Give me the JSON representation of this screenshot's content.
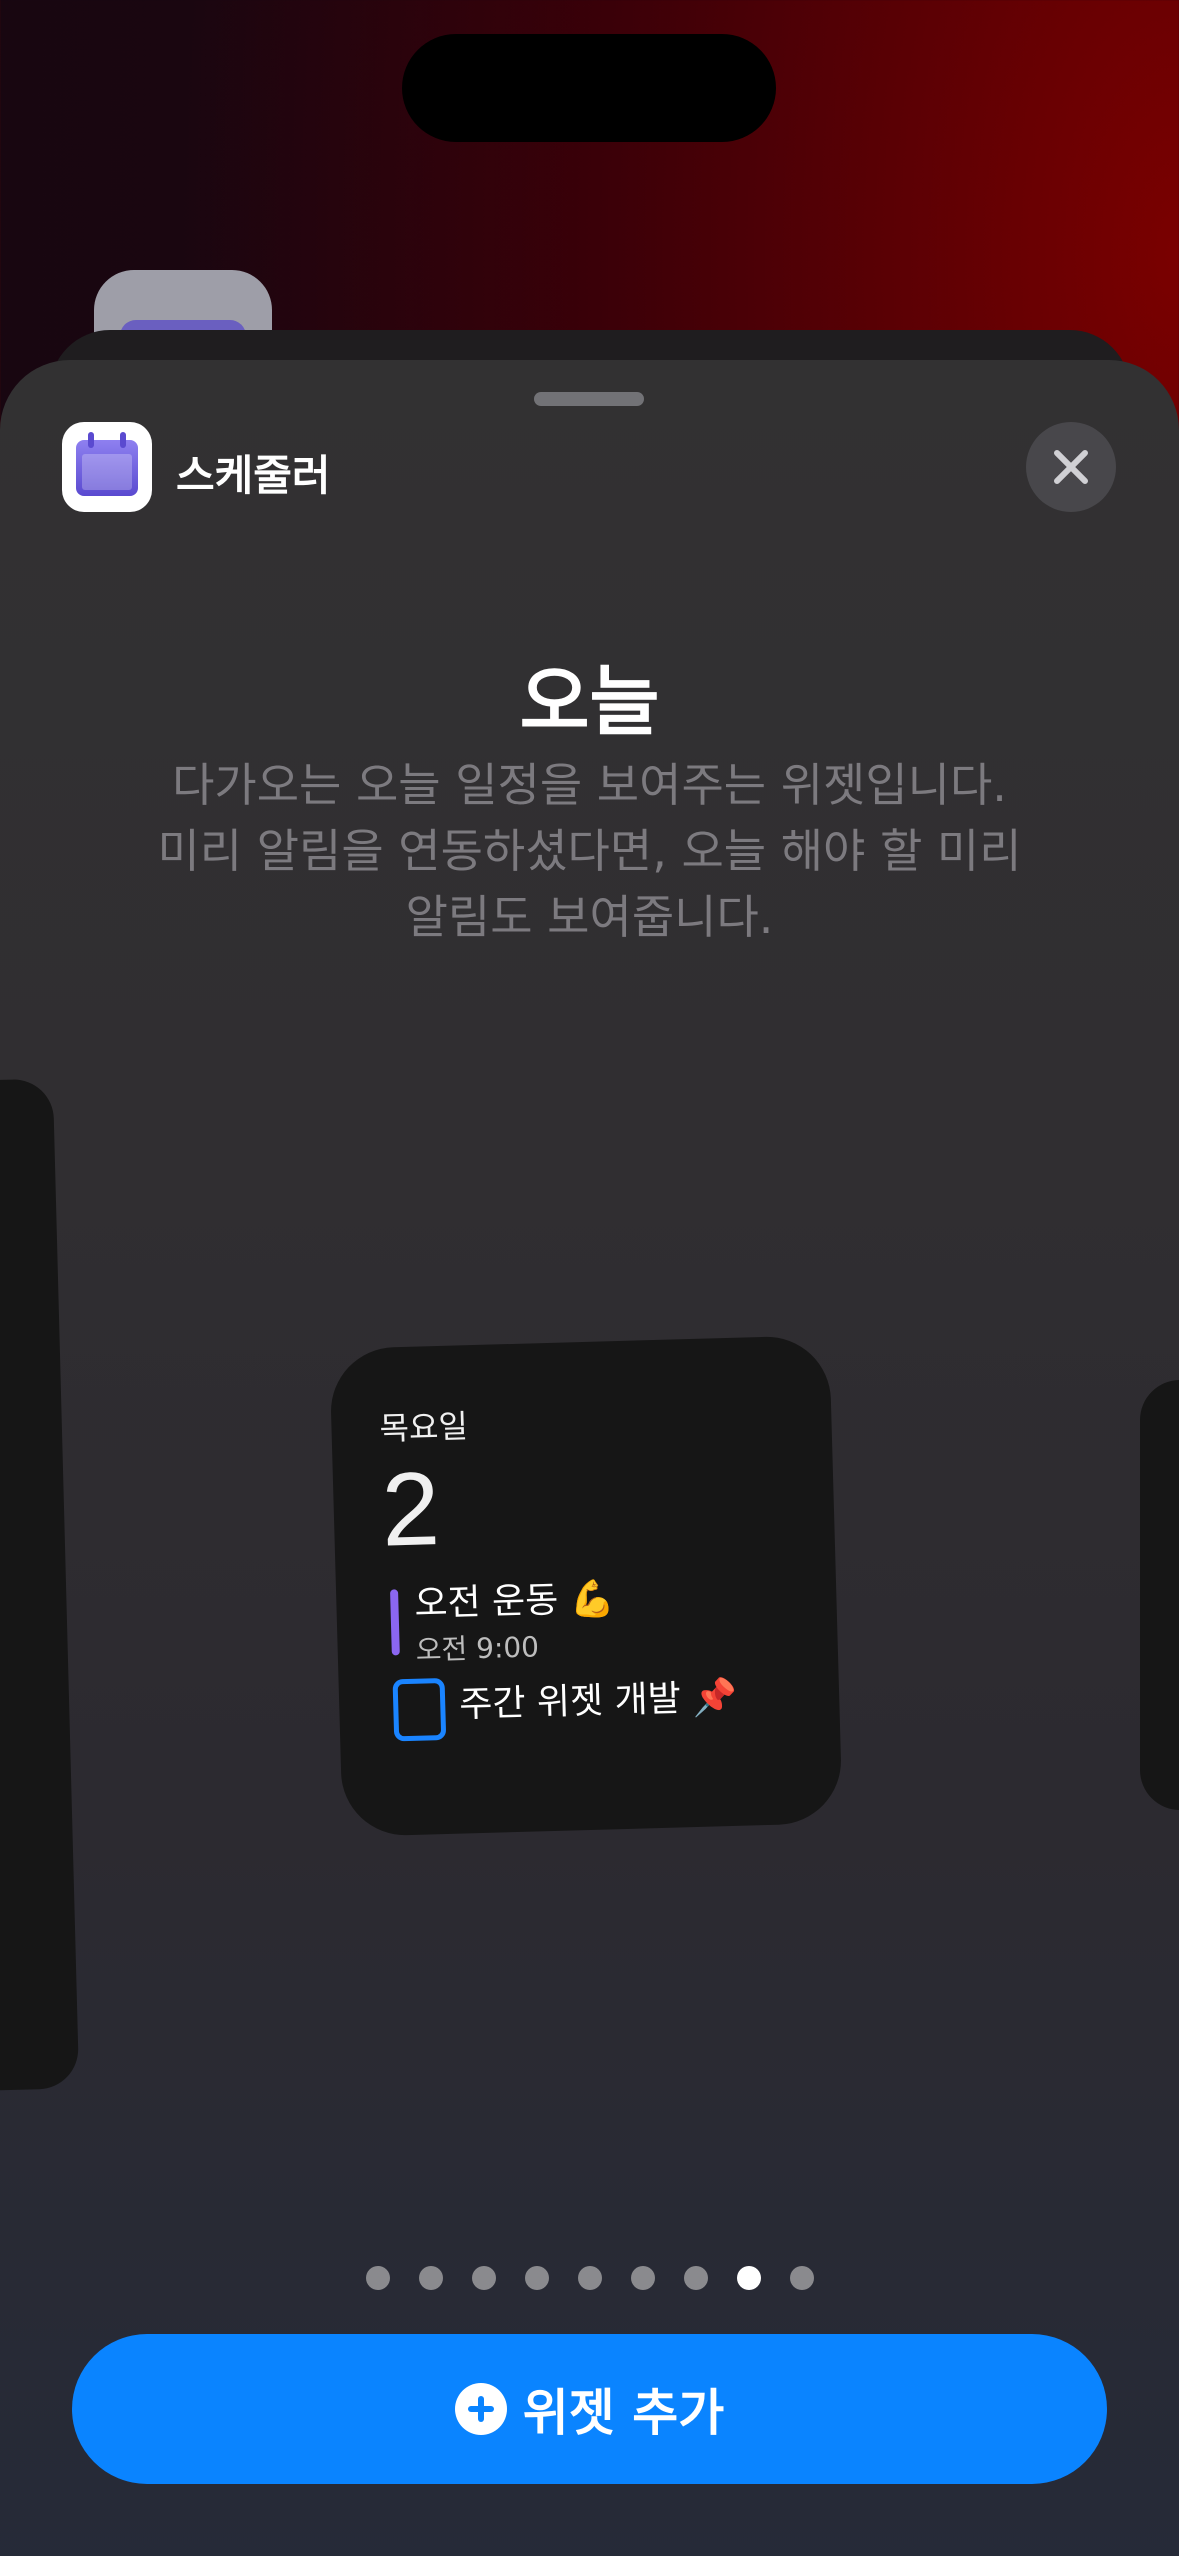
{
  "app": {
    "name": "스케줄러"
  },
  "widget": {
    "title": "오늘",
    "description_lines": [
      "다가오는 오늘 일정을 보여주는 위젯입니다.",
      "미리 알림을 연동하셨다면, 오늘 해야 할 미리",
      "알림도 보여줍니다."
    ],
    "preview": {
      "weekday": "목요일",
      "date": "2",
      "event": {
        "title": "오전 운동 💪",
        "time": "오전 9:00",
        "color": "#8b66f0"
      },
      "todo": {
        "title": "주간 위젯 개발 📌",
        "color": "#1a84ff"
      }
    }
  },
  "pagination": {
    "total": 9,
    "current": 8
  },
  "add_button": {
    "label": "위젯 추가",
    "color": "#0a84ff"
  },
  "icons": {
    "close": "close-icon",
    "plus": "plus-circle-icon",
    "app": "calendar-app-icon"
  }
}
